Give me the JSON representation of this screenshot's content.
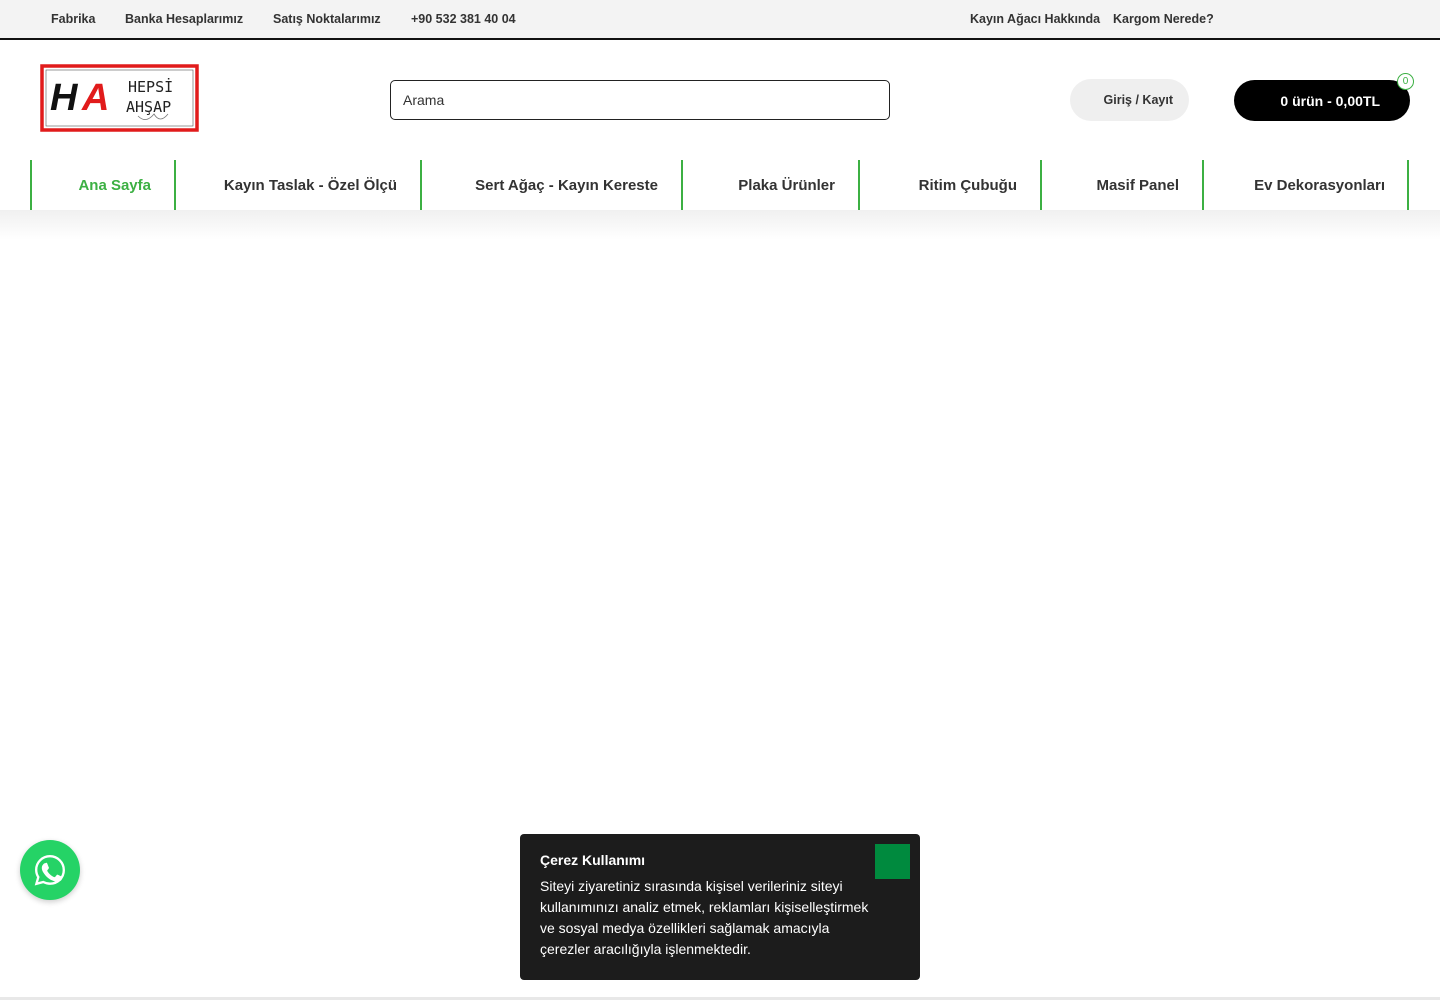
{
  "topbar": {
    "links": [
      "Fabrika",
      "Banka Hesaplarımız",
      "Satış Noktalarımız",
      "+90 532 381 40 04"
    ],
    "right_links": [
      "Kayın Ağacı Hakkında",
      "Kargom Nerede?"
    ]
  },
  "logo": {
    "letters": "HA",
    "line1": "HEPSİ",
    "line2": "AHŞAP"
  },
  "search": {
    "placeholder": "Arama"
  },
  "account": {
    "login_label": "Giriş / Kayıt"
  },
  "cart": {
    "summary": "0 ürün - 0,00TL",
    "count": "0"
  },
  "nav": {
    "items": [
      {
        "label": "Ana Sayfa"
      },
      {
        "label": "Kayın Taslak - Özel Ölçü"
      },
      {
        "label": "Sert Ağaç - Kayın Kereste"
      },
      {
        "label": "Plaka Ürünler"
      },
      {
        "label": "Ritim Çubuğu"
      },
      {
        "label": "Masif Panel"
      },
      {
        "label": "Ev Dekorasyonları"
      }
    ]
  },
  "cookie": {
    "title": "Çerez Kullanımı",
    "text": "Siteyi ziyaretiniz sırasında kişisel verileriniz siteyi kullanımınızı analiz etmek, reklamları kişiselleştirmek ve sosyal medya özellikleri sağlamak amacıyla çerezler aracılığıyla işlenmektedir."
  },
  "colors": {
    "accent_green": "#3cb043",
    "cookie_bg": "#1c1c1c",
    "cookie_close": "#008a3e",
    "whatsapp": "#25d366",
    "logo_red": "#e11b1b"
  },
  "icons": {
    "whatsapp": "whatsapp-icon"
  }
}
